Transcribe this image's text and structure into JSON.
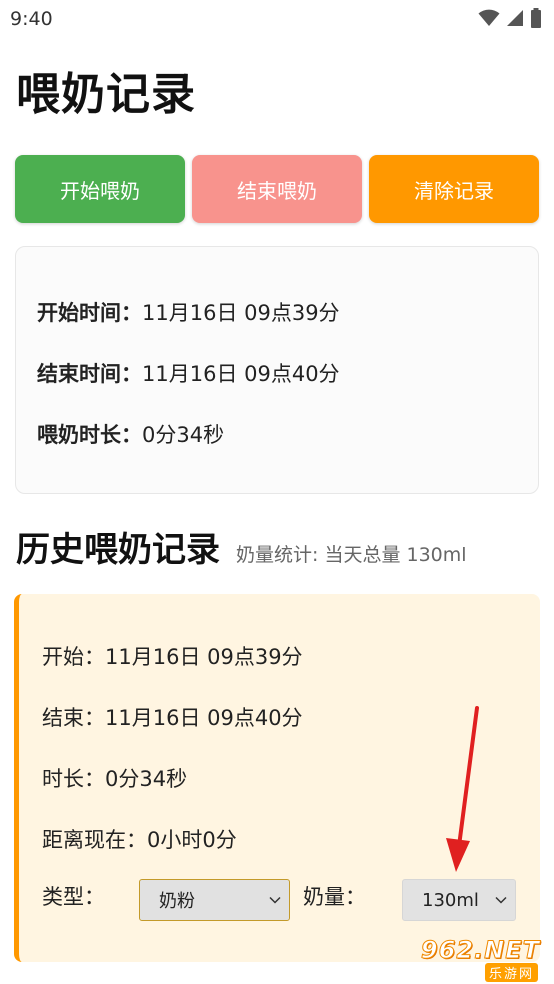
{
  "status_bar": {
    "time": "9:40"
  },
  "page": {
    "title": "喂奶记录"
  },
  "buttons": {
    "start": "开始喂奶",
    "end": "结束喂奶",
    "clear": "清除记录"
  },
  "summary": {
    "start_label": "开始时间：",
    "start_value": "11月16日 09点39分",
    "end_label": "结束时间：",
    "end_value": "11月16日 09点40分",
    "duration_label": "喂奶时长：",
    "duration_value": "0分34秒"
  },
  "history": {
    "title": "历史喂奶记录",
    "stat": "奶量统计: 当天总量 130ml",
    "records": [
      {
        "start": "开始：11月16日 09点39分",
        "end": "结束：11月16日 09点40分",
        "duration": "时长：0分34秒",
        "elapsed": "距离现在：0小时0分",
        "type_label": "类型：",
        "type_value": "奶粉",
        "amount_label": "奶量：",
        "amount_value": "130ml"
      }
    ]
  },
  "watermark": {
    "main": "962.NET",
    "sub": "乐游网"
  },
  "colors": {
    "start_button": "#4caf50",
    "end_button": "#f8938d",
    "clear_button": "#ff9800",
    "record_bg": "#fff5e1",
    "record_accent": "#ff9800",
    "annotation_arrow": "#e02020"
  },
  "icons": [
    "wifi-icon",
    "signal-icon",
    "battery-icon",
    "chevron-down-icon",
    "arrow-annotation"
  ]
}
